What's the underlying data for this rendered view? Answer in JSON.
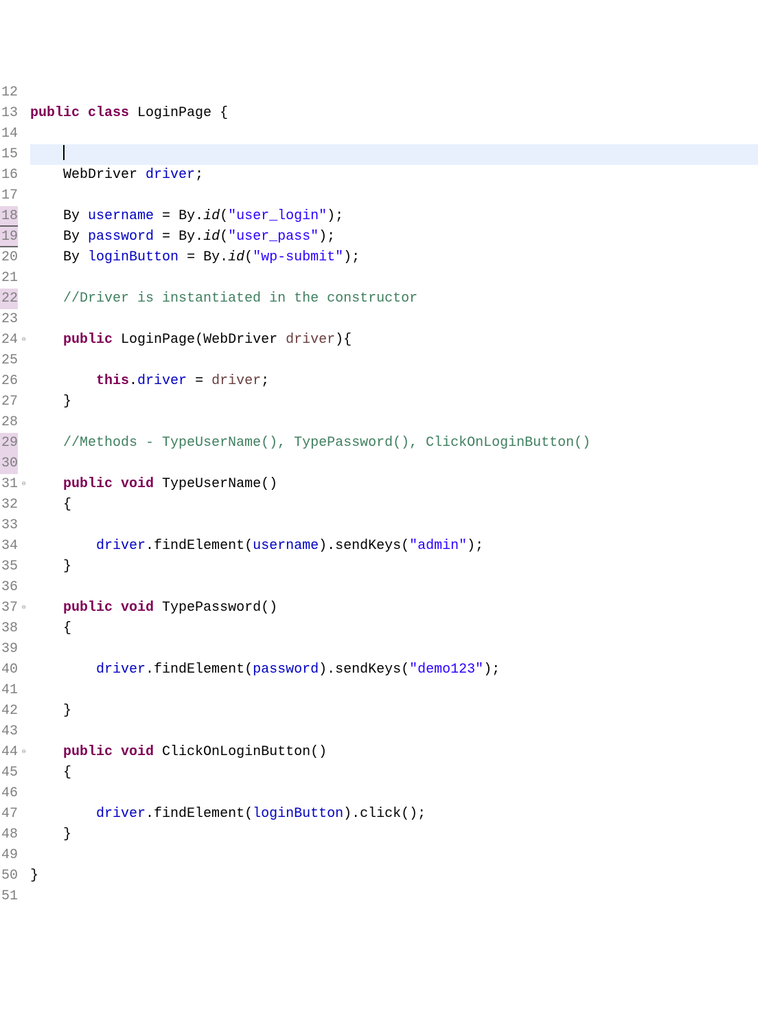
{
  "lines": [
    {
      "num": "12",
      "dirty": false,
      "fold": false,
      "current": false,
      "tokens": []
    },
    {
      "num": "13",
      "dirty": false,
      "fold": false,
      "current": false,
      "tokens": [
        {
          "t": "public ",
          "c": "kw"
        },
        {
          "t": "class ",
          "c": "kw"
        },
        {
          "t": "LoginPage ",
          "c": "type"
        },
        {
          "t": "{",
          "c": "punct"
        }
      ]
    },
    {
      "num": "14",
      "dirty": false,
      "fold": false,
      "current": false,
      "tokens": []
    },
    {
      "num": "15",
      "dirty": false,
      "fold": false,
      "current": true,
      "tokens": [
        {
          "t": "    ",
          "c": ""
        },
        {
          "t": "CURSOR",
          "c": "cursor"
        }
      ]
    },
    {
      "num": "16",
      "dirty": false,
      "fold": false,
      "current": false,
      "tokens": [
        {
          "t": "    ",
          "c": ""
        },
        {
          "t": "WebDriver ",
          "c": "type"
        },
        {
          "t": "driver",
          "c": "field"
        },
        {
          "t": ";",
          "c": "punct"
        }
      ]
    },
    {
      "num": "17",
      "dirty": false,
      "fold": false,
      "current": false,
      "tokens": []
    },
    {
      "num": "18",
      "dirty": true,
      "dirtyUnder": true,
      "fold": false,
      "current": false,
      "tokens": [
        {
          "t": "    ",
          "c": ""
        },
        {
          "t": "By ",
          "c": "type"
        },
        {
          "t": "username",
          "c": "field"
        },
        {
          "t": " = ",
          "c": "punct"
        },
        {
          "t": "By",
          "c": "type"
        },
        {
          "t": ".",
          "c": "punct"
        },
        {
          "t": "id",
          "c": "static-method"
        },
        {
          "t": "(",
          "c": "punct"
        },
        {
          "t": "\"user_login\"",
          "c": "string"
        },
        {
          "t": ");",
          "c": "punct"
        }
      ]
    },
    {
      "num": "19",
      "dirty": true,
      "dirtyUnder": true,
      "fold": false,
      "current": false,
      "tokens": [
        {
          "t": "    ",
          "c": ""
        },
        {
          "t": "By ",
          "c": "type"
        },
        {
          "t": "password",
          "c": "field"
        },
        {
          "t": " = ",
          "c": "punct"
        },
        {
          "t": "By",
          "c": "type"
        },
        {
          "t": ".",
          "c": "punct"
        },
        {
          "t": "id",
          "c": "static-method"
        },
        {
          "t": "(",
          "c": "punct"
        },
        {
          "t": "\"user_pass\"",
          "c": "string"
        },
        {
          "t": ");",
          "c": "punct"
        }
      ]
    },
    {
      "num": "20",
      "dirty": false,
      "fold": false,
      "current": false,
      "tokens": [
        {
          "t": "    ",
          "c": ""
        },
        {
          "t": "By ",
          "c": "type"
        },
        {
          "t": "loginButton",
          "c": "field"
        },
        {
          "t": " = ",
          "c": "punct"
        },
        {
          "t": "By",
          "c": "type"
        },
        {
          "t": ".",
          "c": "punct"
        },
        {
          "t": "id",
          "c": "static-method"
        },
        {
          "t": "(",
          "c": "punct"
        },
        {
          "t": "\"wp-submit\"",
          "c": "string"
        },
        {
          "t": ");",
          "c": "punct"
        }
      ]
    },
    {
      "num": "21",
      "dirty": false,
      "fold": false,
      "current": false,
      "tokens": []
    },
    {
      "num": "22",
      "dirty": true,
      "fold": false,
      "current": false,
      "tokens": [
        {
          "t": "    ",
          "c": ""
        },
        {
          "t": "//Driver is instantiated in the constructor",
          "c": "comment"
        }
      ]
    },
    {
      "num": "23",
      "dirty": false,
      "fold": false,
      "current": false,
      "tokens": []
    },
    {
      "num": "24",
      "dirty": false,
      "fold": true,
      "current": false,
      "tokens": [
        {
          "t": "    ",
          "c": ""
        },
        {
          "t": "public ",
          "c": "kw"
        },
        {
          "t": "LoginPage",
          "c": "type"
        },
        {
          "t": "(",
          "c": "punct"
        },
        {
          "t": "WebDriver ",
          "c": "type"
        },
        {
          "t": "driver",
          "c": "var"
        },
        {
          "t": "){",
          "c": "punct"
        }
      ]
    },
    {
      "num": "25",
      "dirty": false,
      "fold": false,
      "current": false,
      "tokens": []
    },
    {
      "num": "26",
      "dirty": false,
      "fold": false,
      "current": false,
      "tokens": [
        {
          "t": "        ",
          "c": ""
        },
        {
          "t": "this",
          "c": "kw"
        },
        {
          "t": ".",
          "c": "punct"
        },
        {
          "t": "driver",
          "c": "field"
        },
        {
          "t": " = ",
          "c": "punct"
        },
        {
          "t": "driver",
          "c": "var"
        },
        {
          "t": ";",
          "c": "punct"
        }
      ]
    },
    {
      "num": "27",
      "dirty": false,
      "fold": false,
      "current": false,
      "tokens": [
        {
          "t": "    ",
          "c": ""
        },
        {
          "t": "}",
          "c": "punct"
        }
      ]
    },
    {
      "num": "28",
      "dirty": false,
      "fold": false,
      "current": false,
      "tokens": []
    },
    {
      "num": "29",
      "dirty": true,
      "fold": false,
      "current": false,
      "tokens": [
        {
          "t": "    ",
          "c": ""
        },
        {
          "t": "//Methods - TypeUserName(), TypePassword(), ClickOnLoginButton()",
          "c": "comment"
        }
      ]
    },
    {
      "num": "30",
      "dirty": true,
      "fold": false,
      "current": false,
      "tokens": []
    },
    {
      "num": "31",
      "dirty": false,
      "fold": true,
      "current": false,
      "tokens": [
        {
          "t": "    ",
          "c": ""
        },
        {
          "t": "public ",
          "c": "kw"
        },
        {
          "t": "void ",
          "c": "kw"
        },
        {
          "t": "TypeUserName",
          "c": "method"
        },
        {
          "t": "()",
          "c": "punct"
        }
      ]
    },
    {
      "num": "32",
      "dirty": false,
      "fold": false,
      "current": false,
      "tokens": [
        {
          "t": "    ",
          "c": ""
        },
        {
          "t": "{",
          "c": "punct"
        }
      ]
    },
    {
      "num": "33",
      "dirty": false,
      "fold": false,
      "current": false,
      "tokens": []
    },
    {
      "num": "34",
      "dirty": false,
      "fold": false,
      "current": false,
      "tokens": [
        {
          "t": "        ",
          "c": ""
        },
        {
          "t": "driver",
          "c": "field"
        },
        {
          "t": ".",
          "c": "punct"
        },
        {
          "t": "findElement",
          "c": "method"
        },
        {
          "t": "(",
          "c": "punct"
        },
        {
          "t": "username",
          "c": "field"
        },
        {
          "t": ").",
          "c": "punct"
        },
        {
          "t": "sendKeys",
          "c": "method"
        },
        {
          "t": "(",
          "c": "punct"
        },
        {
          "t": "\"admin\"",
          "c": "string"
        },
        {
          "t": ");",
          "c": "punct"
        }
      ]
    },
    {
      "num": "35",
      "dirty": false,
      "fold": false,
      "current": false,
      "tokens": [
        {
          "t": "    ",
          "c": ""
        },
        {
          "t": "}",
          "c": "punct"
        }
      ]
    },
    {
      "num": "36",
      "dirty": false,
      "fold": false,
      "current": false,
      "tokens": []
    },
    {
      "num": "37",
      "dirty": false,
      "fold": true,
      "current": false,
      "tokens": [
        {
          "t": "    ",
          "c": ""
        },
        {
          "t": "public ",
          "c": "kw"
        },
        {
          "t": "void ",
          "c": "kw"
        },
        {
          "t": "TypePassword",
          "c": "method"
        },
        {
          "t": "()",
          "c": "punct"
        }
      ]
    },
    {
      "num": "38",
      "dirty": false,
      "fold": false,
      "current": false,
      "tokens": [
        {
          "t": "    ",
          "c": ""
        },
        {
          "t": "{",
          "c": "punct"
        }
      ]
    },
    {
      "num": "39",
      "dirty": false,
      "fold": false,
      "current": false,
      "tokens": []
    },
    {
      "num": "40",
      "dirty": false,
      "fold": false,
      "current": false,
      "tokens": [
        {
          "t": "        ",
          "c": ""
        },
        {
          "t": "driver",
          "c": "field"
        },
        {
          "t": ".",
          "c": "punct"
        },
        {
          "t": "findElement",
          "c": "method"
        },
        {
          "t": "(",
          "c": "punct"
        },
        {
          "t": "password",
          "c": "field"
        },
        {
          "t": ").",
          "c": "punct"
        },
        {
          "t": "sendKeys",
          "c": "method"
        },
        {
          "t": "(",
          "c": "punct"
        },
        {
          "t": "\"demo123\"",
          "c": "string"
        },
        {
          "t": ");",
          "c": "punct"
        }
      ]
    },
    {
      "num": "41",
      "dirty": false,
      "fold": false,
      "current": false,
      "tokens": []
    },
    {
      "num": "42",
      "dirty": false,
      "fold": false,
      "current": false,
      "tokens": [
        {
          "t": "    ",
          "c": ""
        },
        {
          "t": "}",
          "c": "punct"
        }
      ]
    },
    {
      "num": "43",
      "dirty": false,
      "fold": false,
      "current": false,
      "tokens": []
    },
    {
      "num": "44",
      "dirty": false,
      "fold": true,
      "current": false,
      "tokens": [
        {
          "t": "    ",
          "c": ""
        },
        {
          "t": "public ",
          "c": "kw"
        },
        {
          "t": "void ",
          "c": "kw"
        },
        {
          "t": "ClickOnLoginButton",
          "c": "method"
        },
        {
          "t": "()",
          "c": "punct"
        }
      ]
    },
    {
      "num": "45",
      "dirty": false,
      "fold": false,
      "current": false,
      "tokens": [
        {
          "t": "    ",
          "c": ""
        },
        {
          "t": "{",
          "c": "punct"
        }
      ]
    },
    {
      "num": "46",
      "dirty": false,
      "fold": false,
      "current": false,
      "tokens": []
    },
    {
      "num": "47",
      "dirty": false,
      "fold": false,
      "current": false,
      "tokens": [
        {
          "t": "        ",
          "c": ""
        },
        {
          "t": "driver",
          "c": "field"
        },
        {
          "t": ".",
          "c": "punct"
        },
        {
          "t": "findElement",
          "c": "method"
        },
        {
          "t": "(",
          "c": "punct"
        },
        {
          "t": "loginButton",
          "c": "field"
        },
        {
          "t": ").",
          "c": "punct"
        },
        {
          "t": "click",
          "c": "method"
        },
        {
          "t": "();",
          "c": "punct"
        }
      ]
    },
    {
      "num": "48",
      "dirty": false,
      "fold": false,
      "current": false,
      "tokens": [
        {
          "t": "    ",
          "c": ""
        },
        {
          "t": "}",
          "c": "punct"
        }
      ]
    },
    {
      "num": "49",
      "dirty": false,
      "fold": false,
      "current": false,
      "tokens": []
    },
    {
      "num": "50",
      "dirty": false,
      "fold": false,
      "current": false,
      "tokens": [
        {
          "t": "}",
          "c": "punct"
        }
      ]
    },
    {
      "num": "51",
      "dirty": false,
      "fold": false,
      "current": false,
      "tokens": []
    }
  ]
}
